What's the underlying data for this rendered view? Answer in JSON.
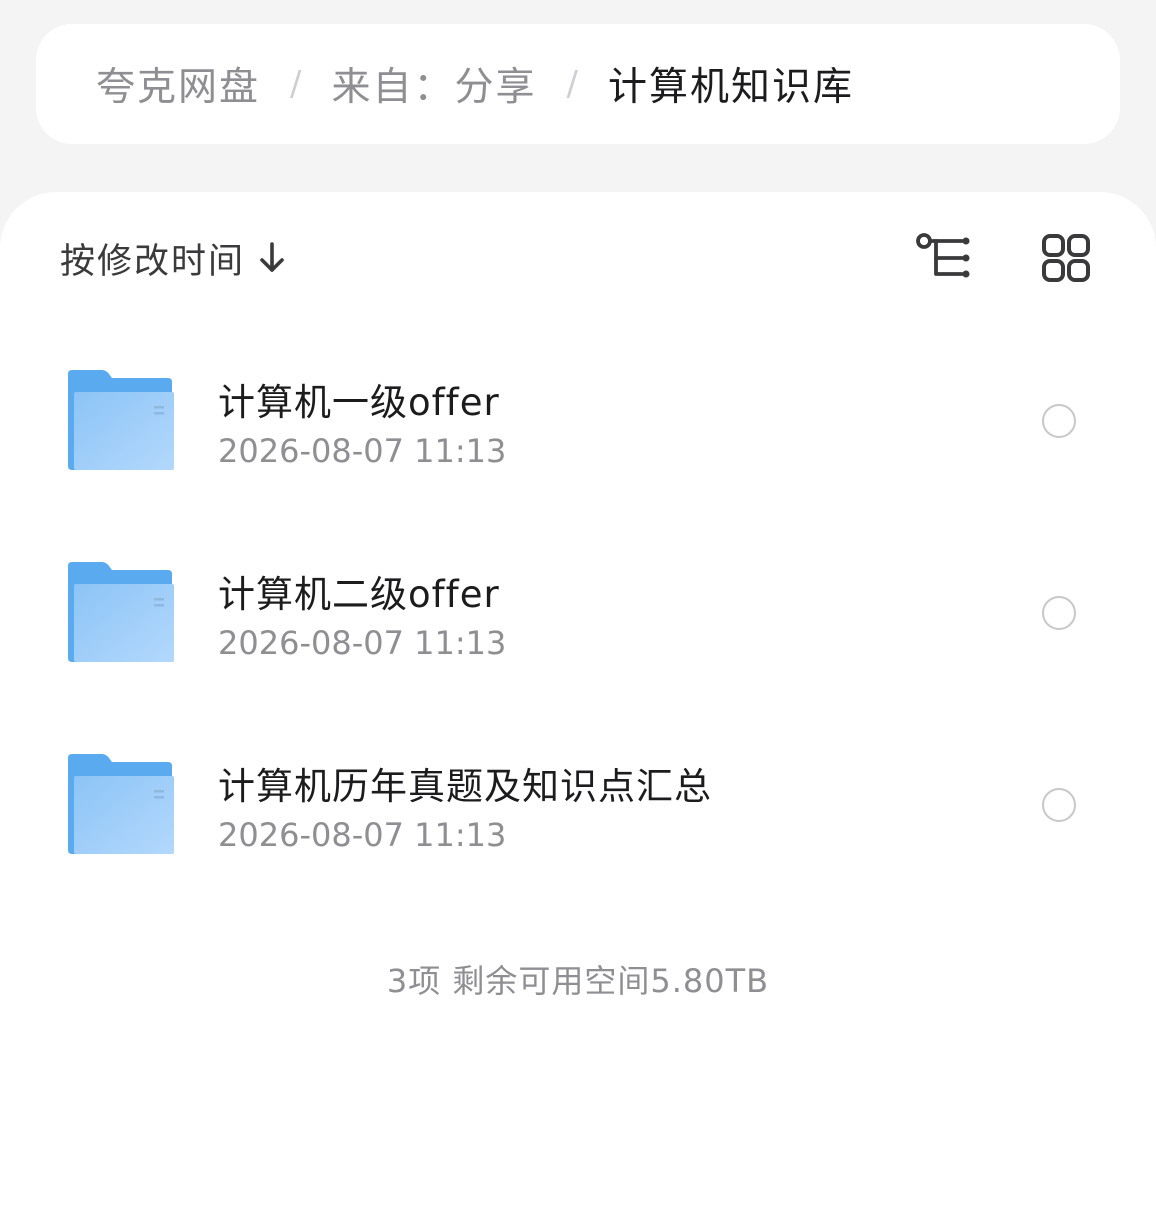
{
  "breadcrumb": {
    "items": [
      "夸克网盘",
      "来自：分享",
      "计算机知识库"
    ],
    "separator": "/"
  },
  "toolbar": {
    "sort_label": "按修改时间",
    "sort_direction_icon": "arrow-down-icon",
    "tree_view_icon": "tree-view-icon",
    "grid_view_icon": "grid-view-icon"
  },
  "files": [
    {
      "name": "计算机一级offer",
      "date": "2026-08-07 11:13",
      "icon": "folder-icon"
    },
    {
      "name": "计算机二级offer",
      "date": "2026-08-07 11:13",
      "icon": "folder-icon"
    },
    {
      "name": "计算机历年真题及知识点汇总",
      "date": "2026-08-07 11:13",
      "icon": "folder-icon"
    }
  ],
  "footer": {
    "summary": "3项 剩余可用空间5.80TB"
  },
  "colors": {
    "folder_blue": "#6fb3f2",
    "folder_blue_light": "#a9d1fa",
    "text_primary": "#1c1c1e",
    "text_secondary": "#8e8e93",
    "background": "#f4f4f5"
  }
}
